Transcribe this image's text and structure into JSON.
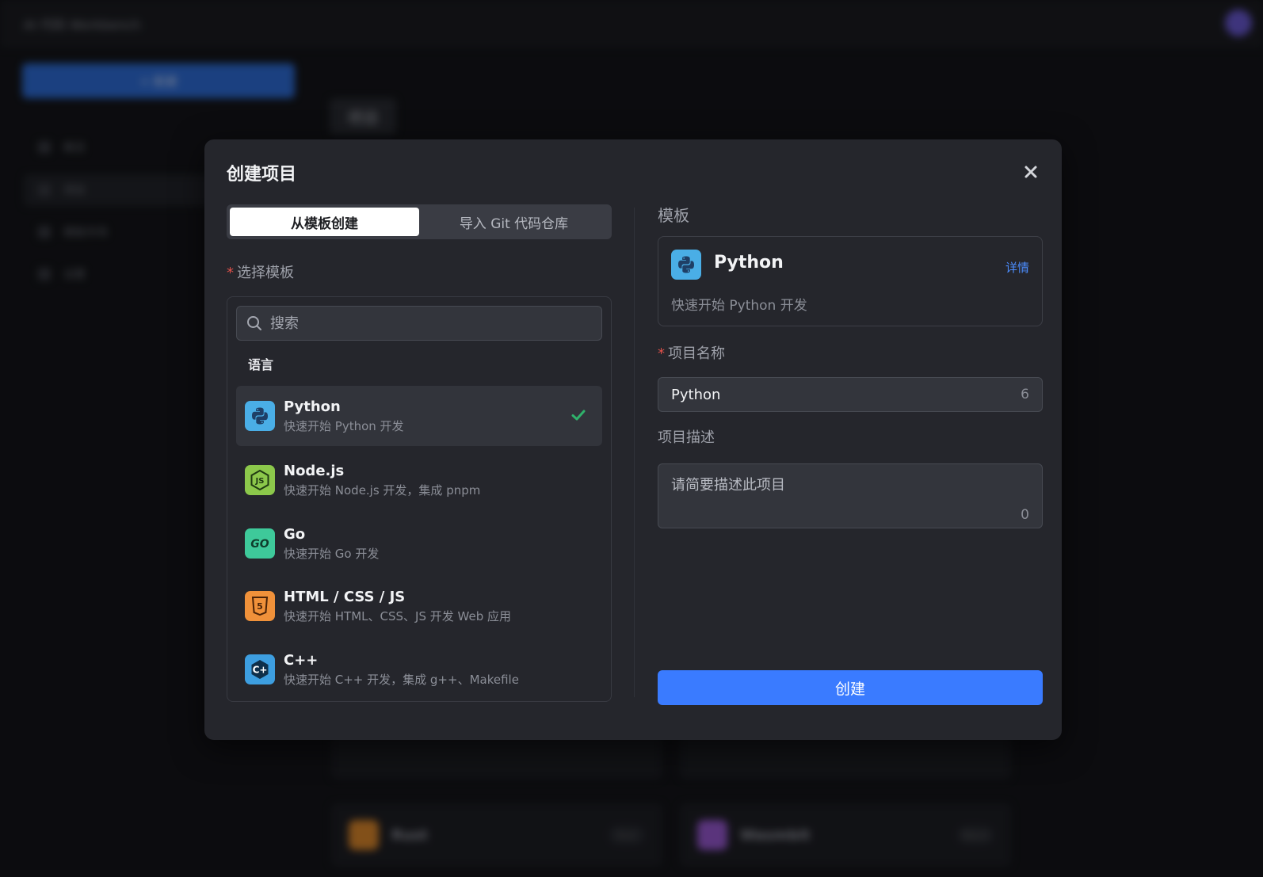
{
  "background": {
    "brand": "AI 代码 Workbench",
    "new_button": "+ 新建",
    "nav": [
      "概览",
      "项目",
      "模板市场",
      "设置"
    ],
    "page_title": "项目",
    "cards": [
      {
        "name": "Rust",
        "pill": "Rust",
        "color": "#e08a2c"
      },
      {
        "name": "Wasmbit",
        "pill": "Wasm",
        "color": "#9b5bd6"
      }
    ]
  },
  "modal": {
    "title": "创建项目",
    "tabs": [
      {
        "label": "从模板创建",
        "active": true
      },
      {
        "label": "导入 Git 代码仓库",
        "active": false
      }
    ],
    "select_label": "选择模板",
    "search_placeholder": "搜索",
    "group_label": "语言",
    "templates": [
      {
        "name": "Python",
        "desc": "快速开始 Python 开发",
        "icon": "python-icon",
        "color": "#4aaee6",
        "selected": true
      },
      {
        "name": "Node.js",
        "desc": "快速开始 Node.js 开发，集成 pnpm",
        "icon": "nodejs-icon",
        "color": "#8cc84b",
        "selected": false
      },
      {
        "name": "Go",
        "desc": "快速开始 Go 开发",
        "icon": "go-icon",
        "color": "#3ec99a",
        "selected": false
      },
      {
        "name": "HTML / CSS / JS",
        "desc": "快速开始 HTML、CSS、JS 开发 Web 应用",
        "icon": "html5-icon",
        "color": "#f0913a",
        "selected": false
      },
      {
        "name": "C++",
        "desc": "快速开始 C++ 开发，集成 g++、Makefile",
        "icon": "cpp-icon",
        "color": "#3d9ee0",
        "selected": false
      }
    ],
    "template_section_label": "模板",
    "selected_template": {
      "name": "Python",
      "desc": "快速开始 Python 开发",
      "detail_link": "详情"
    },
    "project_name_label": "项目名称",
    "project_name_value": "Python",
    "project_name_count": "6",
    "project_desc_label": "项目描述",
    "project_desc_placeholder": "请简要描述此项目",
    "project_desc_count": "0",
    "create_button": "创建"
  },
  "colors": {
    "accent": "#3a7bff",
    "success": "#2fb26b",
    "required": "#e0514a",
    "link": "#4c8dff"
  }
}
